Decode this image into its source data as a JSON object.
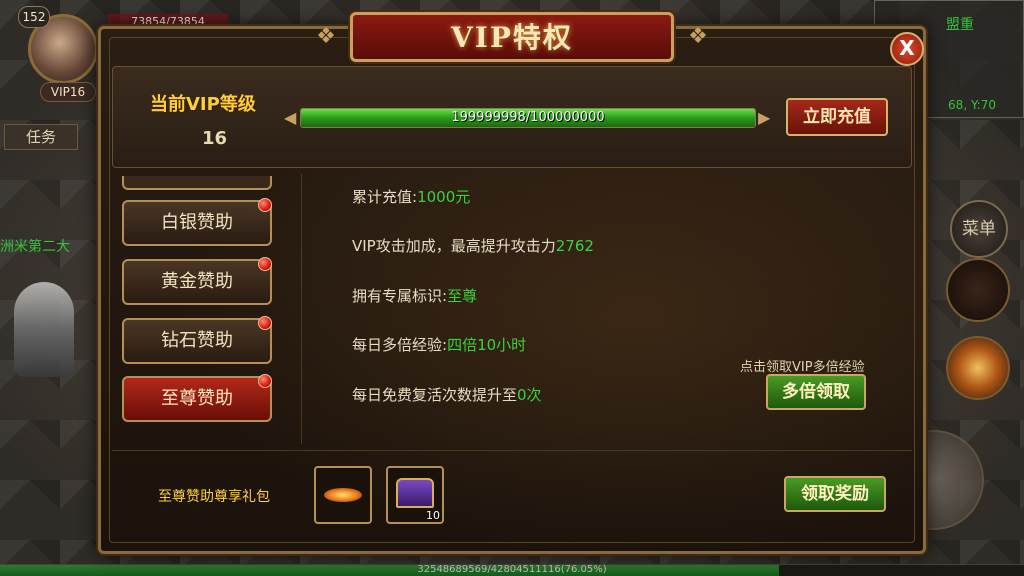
{
  "hud": {
    "player_level": "152",
    "hp_text": "73854/73854",
    "vip_tag": "VIP16",
    "task_button": "任务",
    "left_green_text": "洲米第二大",
    "minimap_name": "盟重",
    "minimap_coord": "68, Y:70",
    "menu_button": "菜单",
    "exp_text": "32548689569/42804511116(76.05%)",
    "exp_percent": 76.05
  },
  "panel": {
    "title": "VIP特权",
    "close_label": "X",
    "vip_level_label": "当前VIP等级",
    "vip_level_value": "16",
    "progress_text": "199999998/100000000",
    "progress_fraction": 1.0,
    "recharge_button": "立即充值",
    "tiers": [
      {
        "label": "白银赞助",
        "active": false
      },
      {
        "label": "黄金赞助",
        "active": false
      },
      {
        "label": "钻石赞助",
        "active": false
      },
      {
        "label": "至尊赞助",
        "active": true
      }
    ],
    "privileges": [
      {
        "text": "累计充值:",
        "value": "1000元"
      },
      {
        "text": "VIP攻击加成，最高提升攻击力",
        "value": "2762"
      },
      {
        "text": "拥有专属标识:",
        "value": "至尊"
      },
      {
        "text": "每日多倍经验:",
        "value": "四倍10小时"
      },
      {
        "text": "每日免费复活次数提升至",
        "value": "0次"
      }
    ],
    "multi_hint": "点击领取VIP多倍经验",
    "multi_button": "多倍领取",
    "gift_label": "至尊赞助尊享礼包",
    "gift_items": [
      {
        "icon": "fire-item-icon",
        "count": ""
      },
      {
        "icon": "treasure-chest-icon",
        "count": "10"
      }
    ],
    "claim_button": "领取奖励"
  },
  "colors": {
    "accent_gold": "#ffcf3a",
    "value_green": "#3ad23a",
    "active_tier_red": "#b2281a"
  }
}
